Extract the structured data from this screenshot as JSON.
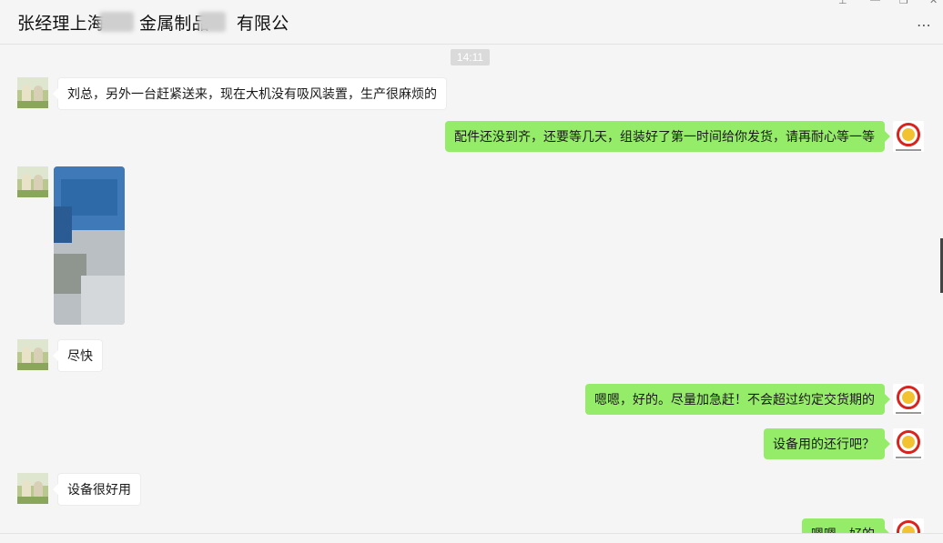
{
  "window": {
    "title": "张经理上海…金属制品…有限公",
    "title_part1": "张经理上海",
    "title_part2": "金属制品",
    "title_part3": "有限公",
    "more_icon": "⋯",
    "pin_icon": "⊥",
    "minimize_icon": "—",
    "maximize_icon": "❐",
    "close_icon": "✕"
  },
  "chat": {
    "timestamp": "14:11",
    "messages": [
      {
        "side": "left",
        "type": "text",
        "text": "刘总，另外一台赶紧送来，现在大机没有吸风装置，生产很麻烦的"
      },
      {
        "side": "right",
        "type": "text",
        "text": "配件还没到齐，还要等几天，组装好了第一时间给你发货，请再耐心等一等"
      },
      {
        "side": "left",
        "type": "image",
        "text": ""
      },
      {
        "side": "left",
        "type": "text",
        "text": "尽快"
      },
      {
        "side": "right",
        "type": "text",
        "text": "嗯嗯，好的。尽量加急赶！不会超过约定交货期的"
      },
      {
        "side": "right",
        "type": "text",
        "text": "设备用的还行吧？"
      },
      {
        "side": "left",
        "type": "text",
        "text": "设备很好用"
      },
      {
        "side": "right",
        "type": "text",
        "text": "嗯嗯，好的"
      }
    ]
  },
  "colors": {
    "bubble_self": "#95ec69",
    "bubble_other": "#ffffff",
    "background": "#f5f5f5"
  }
}
